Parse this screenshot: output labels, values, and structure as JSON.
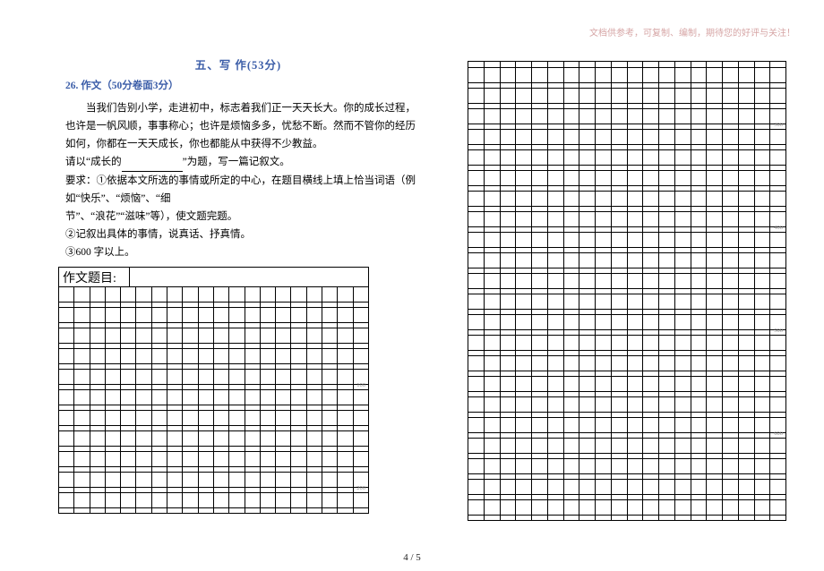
{
  "watermark": "文档供参考，可复制、编制，期待您的好评与关注！",
  "section_title": "五、写  作(53分)",
  "question_label": "26. 作文（50分卷面3分）",
  "paragraph1": "当我们告别小学，走进初中，标志着我们正一天天长大。你的成长过程，也许是一帆风顺，事事称心；也许是烦恼多多，忧愁不断。然而不管你的经历如何，你都在一天天成长，你也都能从中获得不少教益。",
  "prompt_line_pre": "请以“成长的",
  "prompt_line_post": "”为题，写一篇记叙文。",
  "req_label": "要求：",
  "req1_a": "①依据本文所选的事情或所定的中心，在题目横线上填上恰当词语（例如“快乐”、“烦恼”、“细",
  "req1_b": "节”、“浪花”“滋味”等），使文题完题。",
  "req2": "②记叙出具体的事情，说真话、抒真情。",
  "req3": "③600 字以上。",
  "writing_title_label": "作文题目:",
  "markers": {
    "m100": "100",
    "m200": "200",
    "m300": "300",
    "m400": "400",
    "m500": "500",
    "m600": "600"
  },
  "footer": "4 / 5"
}
